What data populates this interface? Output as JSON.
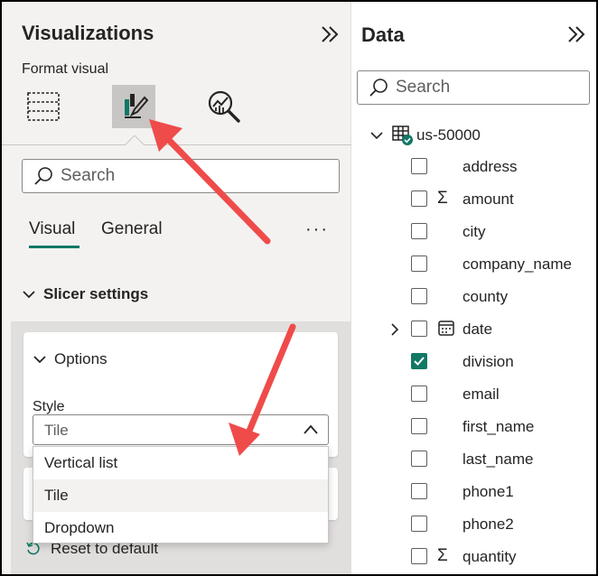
{
  "viz_pane": {
    "title": "Visualizations",
    "format_label": "Format visual",
    "search_placeholder": "Search",
    "tabs": [
      "Visual",
      "General"
    ],
    "more": "···",
    "section": "Slicer settings",
    "options_title": "Options",
    "style_label": "Style",
    "style_value": "Tile",
    "dropdown_options": [
      "Vertical list",
      "Tile",
      "Dropdown"
    ],
    "selected_option": "Tile",
    "reset_label": "Reset to default"
  },
  "data_pane": {
    "title": "Data",
    "search_placeholder": "Search",
    "table_name": "us-50000",
    "fields": [
      {
        "name": "address",
        "checked": false,
        "icon": ""
      },
      {
        "name": "amount",
        "checked": false,
        "icon": "sigma-icon"
      },
      {
        "name": "city",
        "checked": false,
        "icon": ""
      },
      {
        "name": "company_name",
        "checked": false,
        "icon": ""
      },
      {
        "name": "county",
        "checked": false,
        "icon": ""
      },
      {
        "name": "date",
        "checked": false,
        "icon": "calendar-icon",
        "expandable": true
      },
      {
        "name": "division",
        "checked": true,
        "icon": ""
      },
      {
        "name": "email",
        "checked": false,
        "icon": ""
      },
      {
        "name": "first_name",
        "checked": false,
        "icon": ""
      },
      {
        "name": "last_name",
        "checked": false,
        "icon": ""
      },
      {
        "name": "phone1",
        "checked": false,
        "icon": ""
      },
      {
        "name": "phone2",
        "checked": false,
        "icon": ""
      },
      {
        "name": "quantity",
        "checked": false,
        "icon": "sigma-icon"
      }
    ]
  },
  "colors": {
    "accent": "#117865",
    "annotation_arrow": "#ef4b4b"
  }
}
